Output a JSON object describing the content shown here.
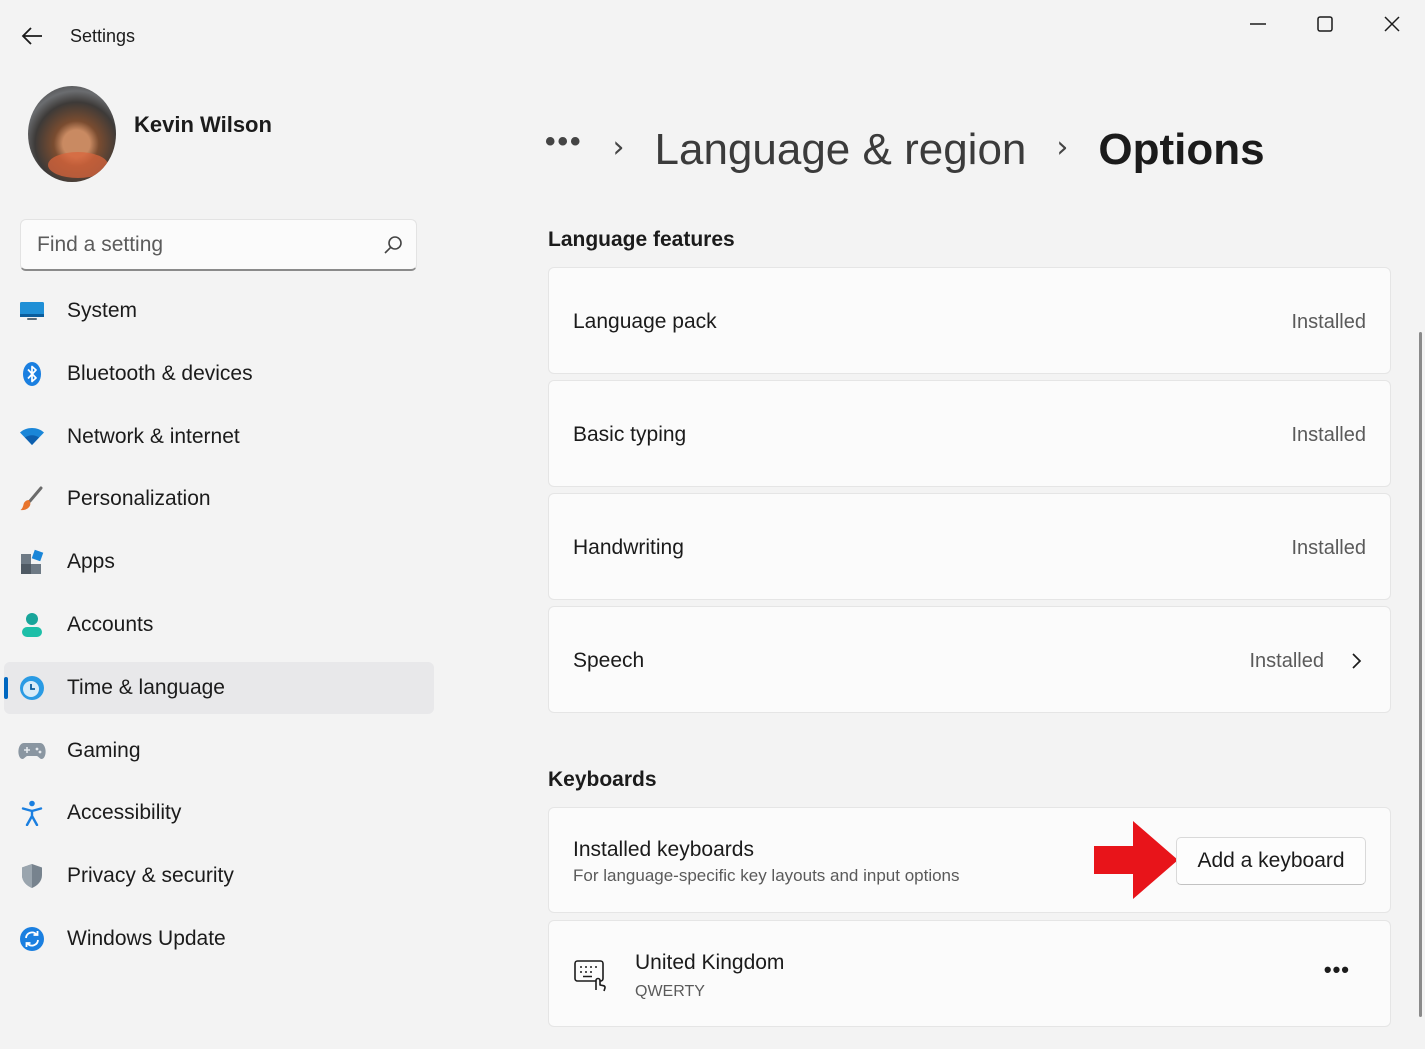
{
  "window": {
    "title": "Settings"
  },
  "user": {
    "name": "Kevin Wilson"
  },
  "search": {
    "placeholder": "Find a setting"
  },
  "nav": {
    "items": [
      {
        "label": "System",
        "icon": "monitor-icon"
      },
      {
        "label": "Bluetooth & devices",
        "icon": "bluetooth-icon"
      },
      {
        "label": "Network & internet",
        "icon": "wifi-icon"
      },
      {
        "label": "Personalization",
        "icon": "brush-icon"
      },
      {
        "label": "Apps",
        "icon": "apps-icon"
      },
      {
        "label": "Accounts",
        "icon": "person-icon"
      },
      {
        "label": "Time & language",
        "icon": "clock-globe-icon",
        "active": true
      },
      {
        "label": "Gaming",
        "icon": "gamepad-icon"
      },
      {
        "label": "Accessibility",
        "icon": "accessibility-icon"
      },
      {
        "label": "Privacy & security",
        "icon": "shield-icon"
      },
      {
        "label": "Windows Update",
        "icon": "sync-icon"
      }
    ]
  },
  "breadcrumb": {
    "more": "•••",
    "parent": "Language & region",
    "current": "Options"
  },
  "language_features": {
    "title": "Language features",
    "items": [
      {
        "label": "Language pack",
        "status": "Installed"
      },
      {
        "label": "Basic typing",
        "status": "Installed"
      },
      {
        "label": "Handwriting",
        "status": "Installed"
      },
      {
        "label": "Speech",
        "status": "Installed",
        "has_chevron": true
      }
    ]
  },
  "keyboards": {
    "title": "Keyboards",
    "installed_title": "Installed keyboards",
    "installed_subtitle": "For language-specific key layouts and input options",
    "add_button": "Add a keyboard",
    "list": [
      {
        "name": "United Kingdom",
        "layout": "QWERTY",
        "more": "•••"
      }
    ]
  },
  "colors": {
    "accent": "#0067c0",
    "annotation_arrow": "#e8141a"
  }
}
